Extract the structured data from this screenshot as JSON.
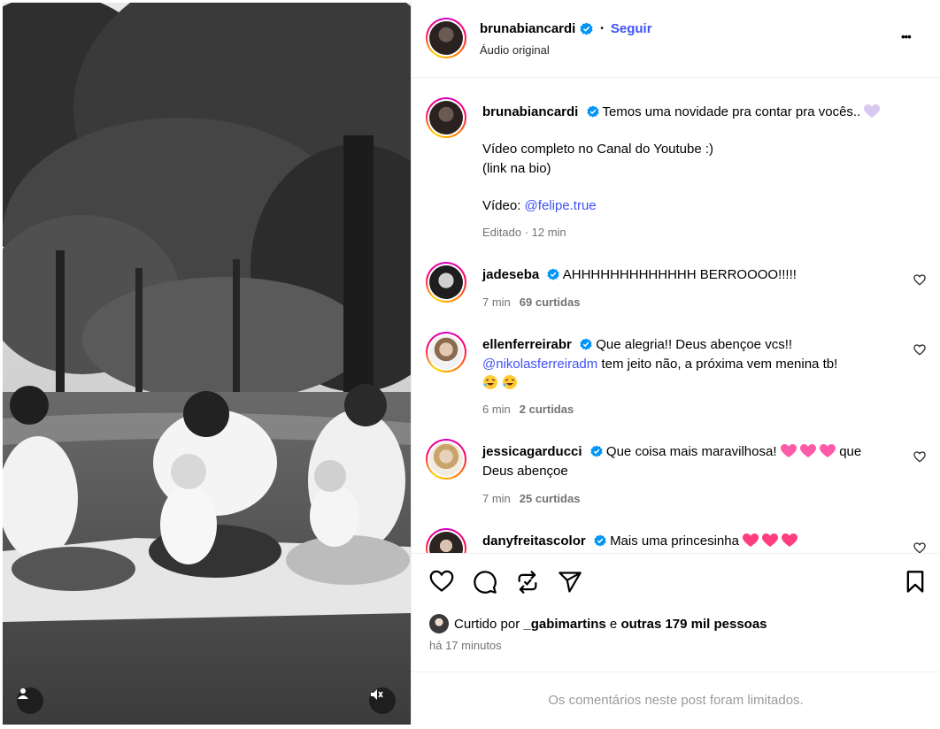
{
  "post": {
    "username": "brunabiancardi",
    "follow_label": "Seguir",
    "audio_label": "Áudio original",
    "more_label": "•••",
    "dot": "•"
  },
  "caption": {
    "username": "brunabiancardi",
    "line1": "Temos uma novidade pra contar pra vocês..",
    "line2": "Vídeo completo no Canal do Youtube :)",
    "line3": "(link na bio)",
    "line4_prefix": "Vídeo:",
    "line4_mention": "@felipe.true",
    "meta": "Editado · 12 min"
  },
  "comments": [
    {
      "username": "jadeseba",
      "text": "AHHHHHHHHHHHHH BERROOOO!!!!!",
      "time": "7 min",
      "likes": "69 curtidas"
    },
    {
      "username": "ellenferreirabr",
      "text": "Que alegria!! Deus abençoe vcs!!",
      "mention": "@nikolasferreiradm",
      "text2": "tem jeito não, a próxima vem menina tb!",
      "time": "6 min",
      "likes": "2 curtidas"
    },
    {
      "username": "jessicagarducci",
      "text": "Que coisa mais maravilhosa!",
      "text_after": "que",
      "text2": "Deus abençoe",
      "time": "7 min",
      "likes": "25 curtidas"
    },
    {
      "username": "danyfreitascolor",
      "text": "Mais uma princesinha"
    }
  ],
  "likes": {
    "prefix": "Curtido por",
    "user": "_gabimartins",
    "middle": "e",
    "rest": "outras 179 mil pessoas",
    "ago": "há 17 minutos"
  },
  "footer": {
    "text": "Os comentários neste post foram limitados."
  },
  "colors": {
    "accent": "#3f51f7",
    "verified": "#0095f6",
    "muted": "#737373"
  },
  "icons": [
    "heart-icon",
    "comment-icon",
    "repost-icon",
    "share-icon",
    "bookmark-icon",
    "verified-icon",
    "user-tag-icon",
    "mute-icon",
    "more-icon"
  ]
}
